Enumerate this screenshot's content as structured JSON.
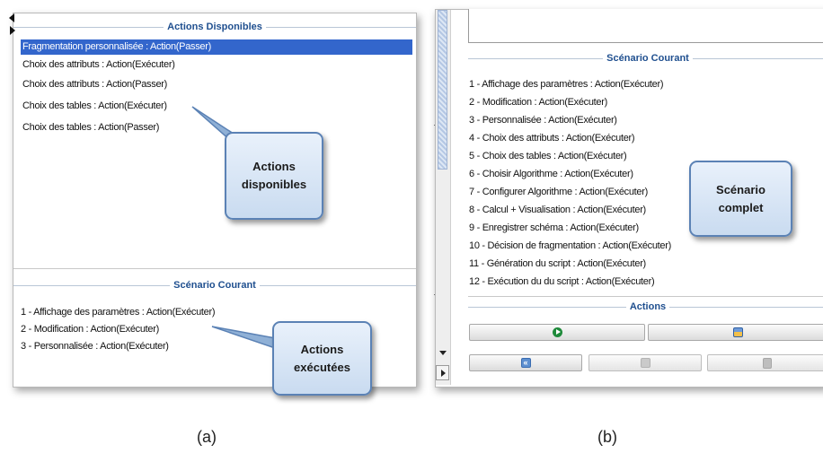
{
  "panel_a": {
    "available": {
      "title": "Actions Disponibles",
      "items": [
        "Fragmentation personnalisée : Action(Passer)",
        "Choix des attributs : Action(Exécuter)",
        "Choix des attributs : Action(Passer)",
        "Choix des tables : Action(Exécuter)",
        "Choix des tables : Action(Passer)"
      ],
      "selected_index": 0
    },
    "current": {
      "title": "Scénario Courant",
      "items": [
        "1 - Affichage des paramètres : Action(Exécuter)",
        "2 - Modification : Action(Exécuter)",
        "3 - Personnalisée : Action(Exécuter)"
      ]
    },
    "callout_available": "Actions\ndisponibles",
    "callout_executed": "Actions\nexécutées",
    "caption": "(a)"
  },
  "panel_b": {
    "current": {
      "title": "Scénario Courant",
      "items": [
        "1 - Affichage des paramètres : Action(Exécuter)",
        "2 - Modification : Action(Exécuter)",
        "3 - Personnalisée : Action(Exécuter)",
        "4 - Choix des attributs : Action(Exécuter)",
        "5 - Choix des tables : Action(Exécuter)",
        "6 - Choisir Algorithme : Action(Exécuter)",
        "7 - Configurer Algorithme : Action(Exécuter)",
        "8 - Calcul + Visualisation : Action(Exécuter)",
        "9 - Enregistrer schéma : Action(Exécuter)",
        "10 - Décision de fragmentation : Action(Exécuter)",
        "11 - Génération du script : Action(Exécuter)",
        "12 - Exécution du  du script : Action(Exécuter)"
      ]
    },
    "actions_title": "Actions",
    "callout_complete": "Scénario\ncomplet",
    "caption": "(b)"
  },
  "icons": {
    "run": "play-icon",
    "save": "save-icon",
    "back": "rewind-icon",
    "next": "next-icon",
    "stop": "stop-icon"
  },
  "colors": {
    "selection": "#3366cc",
    "title": "#1f4f8f",
    "callout_border": "#5b82b5",
    "play": "#1e8a3a"
  }
}
